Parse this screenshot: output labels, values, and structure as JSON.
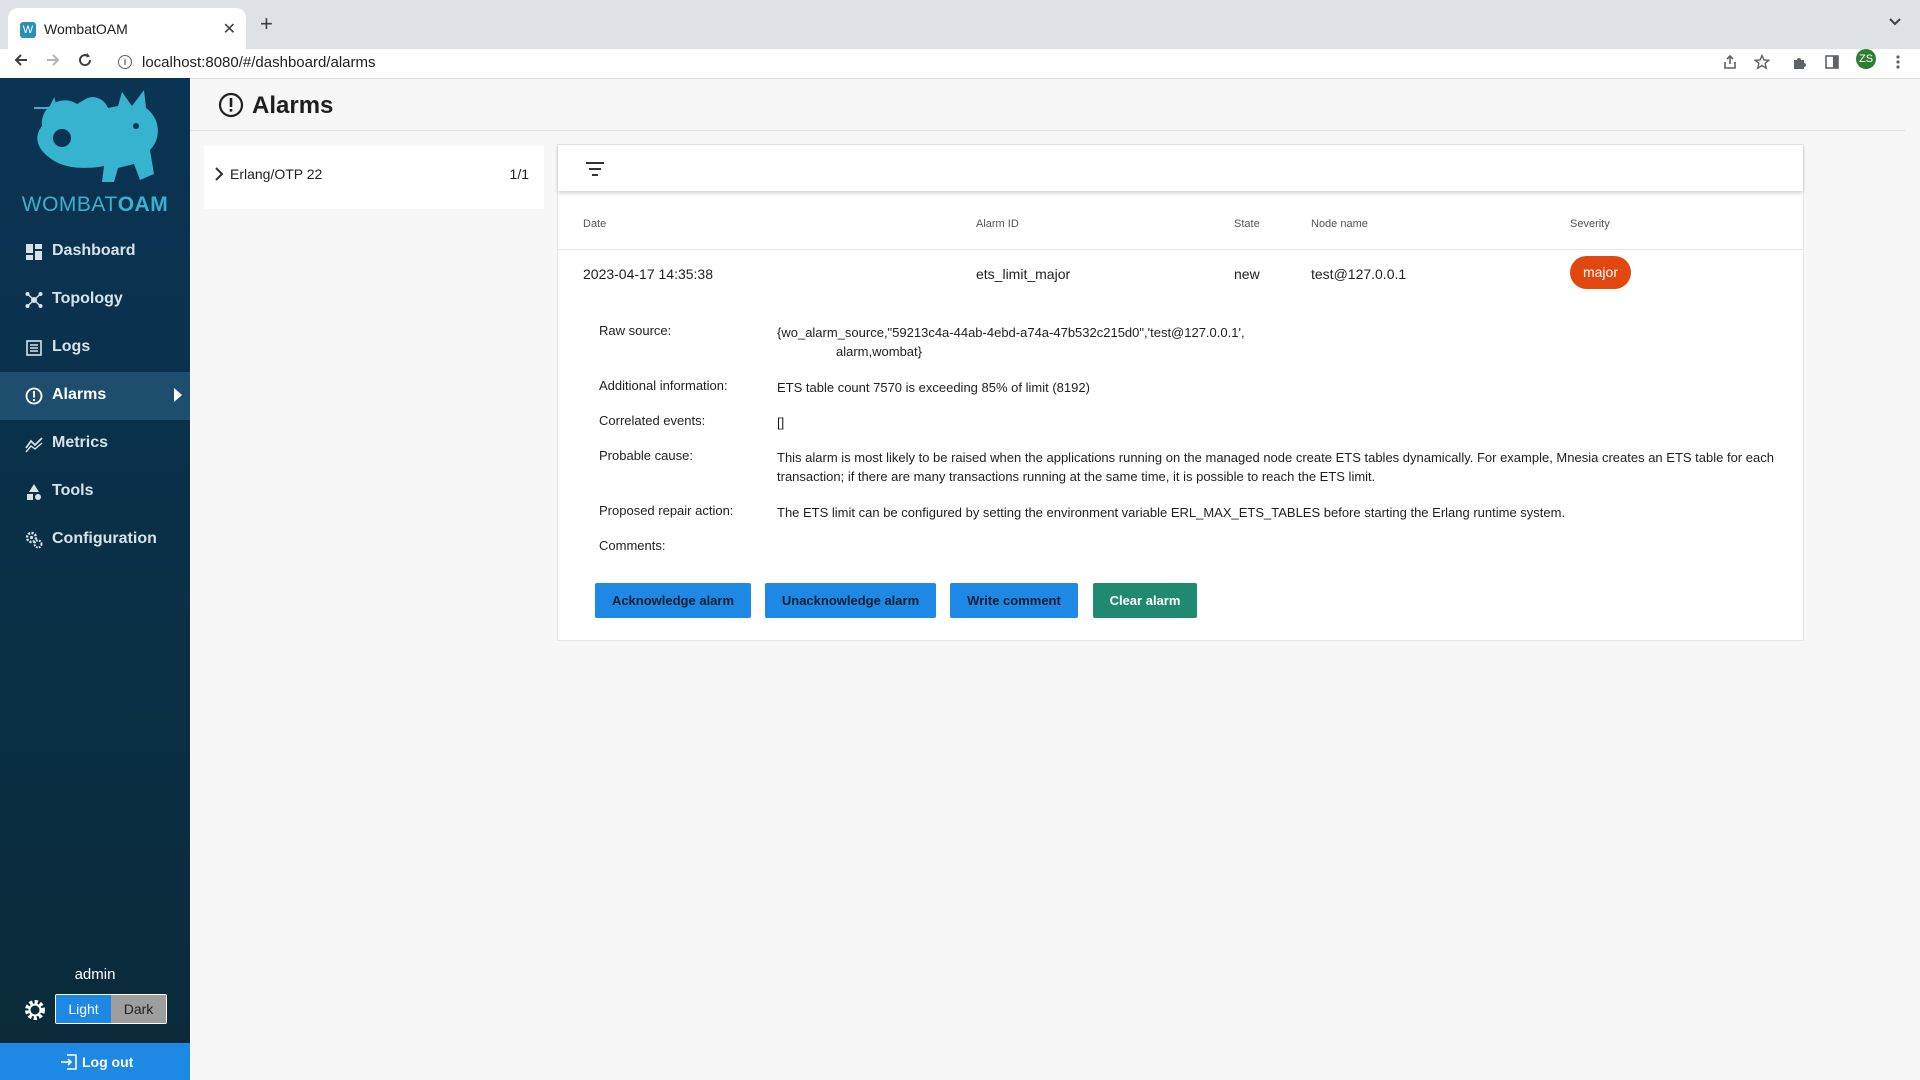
{
  "browser": {
    "tab_title": "WombatOAM",
    "tab_favicon": "W",
    "tab_close": "✕",
    "new_tab": "+",
    "url": "localhost:8080/#/dashboard/alarms",
    "profile_initials": "ZS",
    "icons": [
      "back-arrow-icon",
      "forward-arrow-icon",
      "reload-icon",
      "info-icon",
      "share-icon",
      "star-icon",
      "extensions-icon",
      "side-panel-icon",
      "kebab-menu-icon"
    ]
  },
  "sidebar": {
    "logo_text_light": "WOMBAT",
    "logo_text_bold": "OAM",
    "items": [
      {
        "label": "Dashboard",
        "icon": "dashboard-icon"
      },
      {
        "label": "Topology",
        "icon": "topology-icon"
      },
      {
        "label": "Logs",
        "icon": "logs-icon"
      },
      {
        "label": "Alarms",
        "icon": "alarm-icon",
        "active": true
      },
      {
        "label": "Metrics",
        "icon": "metrics-icon"
      },
      {
        "label": "Tools",
        "icon": "tools-icon"
      },
      {
        "label": "Configuration",
        "icon": "configuration-icon"
      }
    ],
    "user": "admin",
    "theme": {
      "light": "Light",
      "dark": "Dark",
      "selected": "Light"
    },
    "logout": "Log out"
  },
  "page": {
    "title": "Alarms"
  },
  "groups": [
    {
      "name": "Erlang/OTP 22",
      "count": "1/1"
    }
  ],
  "table": {
    "headers": {
      "date": "Date",
      "alarm_id": "Alarm ID",
      "state": "State",
      "node": "Node name",
      "severity": "Severity"
    },
    "row": {
      "date": "2023-04-17 14:35:38",
      "alarm_id": "ets_limit_major",
      "state": "new",
      "node": "test@127.0.0.1",
      "severity": "major"
    }
  },
  "details": {
    "raw_source_label": "Raw source:",
    "raw_source_line1": "{wo_alarm_source,\"59213c4a-44ab-4ebd-a74a-47b532c215d0\",'test@127.0.0.1',",
    "raw_source_line2": "alarm,wombat}",
    "additional_label": "Additional information:",
    "additional": "ETS table count 7570 is exceeding 85% of limit (8192)",
    "correlated_label": "Correlated events:",
    "correlated": "[]",
    "cause_label": "Probable cause:",
    "cause": "This alarm is most likely to be raised when the applications running on the managed node create ETS tables dynamically. For example, Mnesia creates an ETS table for each transaction; if there are many transactions running at the same time, it is possible to reach the ETS limit.",
    "repair_label": "Proposed repair action:",
    "repair": "The ETS limit can be configured by setting the environment variable ERL_MAX_ETS_TABLES before starting the Erlang runtime system.",
    "comments_label": "Comments:"
  },
  "actions": {
    "acknowledge": "Acknowledge alarm",
    "unacknowledge": "Unacknowledge alarm",
    "comment": "Write comment",
    "clear": "Clear alarm"
  },
  "colors": {
    "accent": "#1e88e5",
    "severity_major": "#e2470f",
    "clear_button": "#1f8a6f",
    "sidebar": "#0b3454",
    "logo": "#36b3cf"
  }
}
